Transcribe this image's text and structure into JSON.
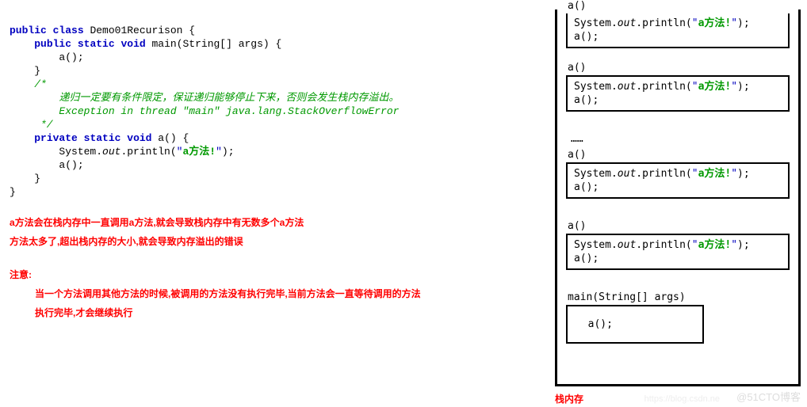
{
  "code": {
    "l1": "public class Demo01Recurison {",
    "l2": "    public static void main(String[] args) {",
    "l3": "        a();",
    "l4": "    }",
    "l5": "",
    "l6": "    /*",
    "l7": "        递归一定要有条件限定，保证递归能够停止下来，否则会发生栈内存溢出。",
    "l8": "        Exception in thread \"main\" java.lang.StackOverflowError",
    "l9": "     */",
    "l10": "    private static void a() {",
    "l11_a": "        System.",
    "l11_b": "out",
    "l11_c": ".println(",
    "l11_d": "\"",
    "l11_e": "a方法!",
    "l11_f": "\"",
    "l11_g": ");",
    "l12": "        a();",
    "l13": "    }",
    "l14": "}"
  },
  "kw": {
    "public": "public",
    "class": "class",
    "static": "static",
    "void": "void",
    "private": "private"
  },
  "notes": {
    "n1": "a方法会在栈内存中一直调用a方法,就会导致栈内存中有无数多个a方法",
    "n2": "方法太多了,超出栈内存的大小,就会导致内存溢出的错误",
    "n3": "注意:",
    "n4": "当一个方法调用其他方法的时候,被调用的方法没有执行完毕,当前方法会一直等待调用的方法",
    "n5": "执行完毕,才会继续执行"
  },
  "stack": {
    "label": "栈内存",
    "ellipsis": "……",
    "a_call_top": "a()",
    "a_call": "a()",
    "frame_line1a": "System.",
    "frame_line1b": "out",
    "frame_line1c": ".println(",
    "frame_line1d": "\"",
    "frame_line1e": "a方法!",
    "frame_line1f": "\"",
    "frame_line1g": ");",
    "frame_line2": "a();",
    "main_title": "main(String[] args)",
    "main_body": "  a();"
  },
  "watermark": "@51CTO博客",
  "watermark2": "https://blog.csdn.ne"
}
